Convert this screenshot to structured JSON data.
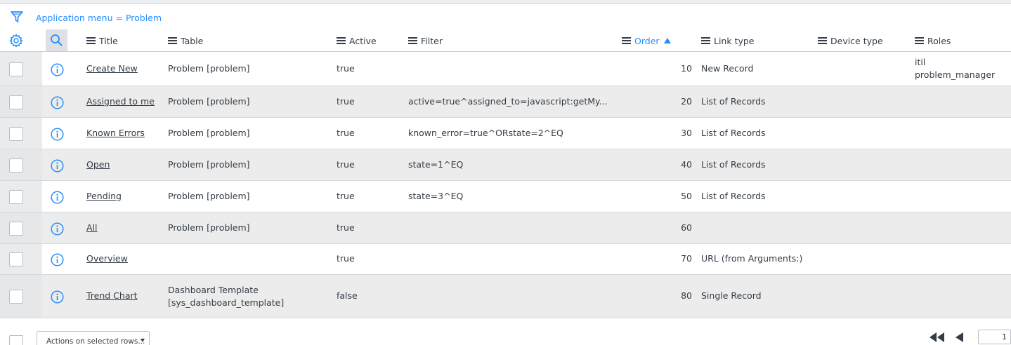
{
  "breadcrumb": {
    "text": "Application menu = Problem"
  },
  "columns": [
    {
      "key": "title",
      "label": "Title"
    },
    {
      "key": "table",
      "label": "Table"
    },
    {
      "key": "active",
      "label": "Active"
    },
    {
      "key": "filter",
      "label": "Filter"
    },
    {
      "key": "order",
      "label": "Order",
      "sorted": "asc"
    },
    {
      "key": "link_type",
      "label": "Link type"
    },
    {
      "key": "device_type",
      "label": "Device type"
    },
    {
      "key": "roles",
      "label": "Roles"
    }
  ],
  "rows": [
    {
      "title": "Create New",
      "table": "Problem [problem]",
      "table2": "",
      "active": "true",
      "filter": "",
      "order": "10",
      "link_type": "New Record",
      "roles": "itil",
      "roles2": "problem_manager"
    },
    {
      "title": "Assigned to me",
      "table": "Problem [problem]",
      "table2": "",
      "active": "true",
      "filter": "active=true^assigned_to=javascript:getMy...",
      "order": "20",
      "link_type": "List of Records",
      "roles": "",
      "roles2": ""
    },
    {
      "title": "Known Errors",
      "table": "Problem [problem]",
      "table2": "",
      "active": "true",
      "filter": "known_error=true^ORstate=2^EQ",
      "order": "30",
      "link_type": "List of Records",
      "roles": "",
      "roles2": ""
    },
    {
      "title": "Open",
      "table": "Problem [problem]",
      "table2": "",
      "active": "true",
      "filter": "state=1^EQ",
      "order": "40",
      "link_type": "List of Records",
      "roles": "",
      "roles2": ""
    },
    {
      "title": "Pending",
      "table": "Problem [problem]",
      "table2": "",
      "active": "true",
      "filter": "state=3^EQ",
      "order": "50",
      "link_type": "List of Records",
      "roles": "",
      "roles2": ""
    },
    {
      "title": "All",
      "table": "Problem [problem]",
      "table2": "",
      "active": "true",
      "filter": "",
      "order": "60",
      "link_type": "",
      "roles": "",
      "roles2": ""
    },
    {
      "title": "Overview",
      "table": "",
      "table2": "",
      "active": "true",
      "filter": "",
      "order": "70",
      "link_type": "URL (from Arguments:)",
      "roles": "",
      "roles2": ""
    },
    {
      "title": "Trend Chart",
      "table": "Dashboard Template",
      "table2": "[sys_dashboard_template]",
      "active": "false",
      "filter": "",
      "order": "80",
      "link_type": "Single Record",
      "roles": "",
      "roles2": ""
    }
  ],
  "footer": {
    "actions_label": "Actions on selected rows...",
    "page_value": "1"
  },
  "colors": {
    "accent": "#278efc",
    "row_alt": "#ececec"
  },
  "icons": [
    "filter-icon",
    "gear-icon",
    "search-icon",
    "info-icon",
    "first-page-icon",
    "previous-page-icon"
  ]
}
